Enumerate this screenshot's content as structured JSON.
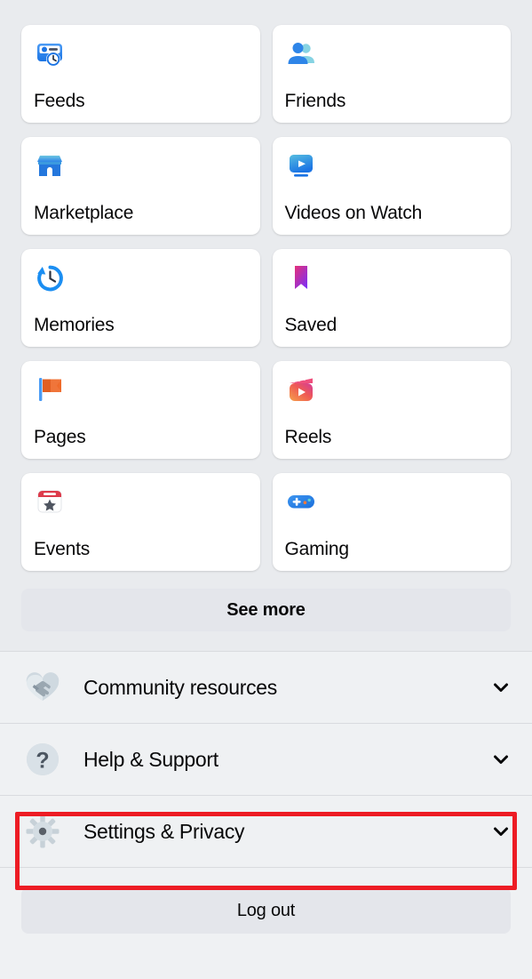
{
  "screen": {
    "name": "facebook-menu",
    "background": "#e9ebee"
  },
  "shortcuts": [
    {
      "label": "Feeds",
      "icon": "feeds-icon"
    },
    {
      "label": "Friends",
      "icon": "friends-icon"
    },
    {
      "label": "Marketplace",
      "icon": "marketplace-icon"
    },
    {
      "label": "Videos on Watch",
      "icon": "videos-on-watch-icon"
    },
    {
      "label": "Memories",
      "icon": "memories-icon"
    },
    {
      "label": "Saved",
      "icon": "saved-bookmark-icon"
    },
    {
      "label": "Pages",
      "icon": "pages-flag-icon"
    },
    {
      "label": "Reels",
      "icon": "reels-icon"
    },
    {
      "label": "Events",
      "icon": "events-calendar-icon"
    },
    {
      "label": "Gaming",
      "icon": "gaming-controller-icon"
    }
  ],
  "see_more": {
    "label": "See more"
  },
  "rows": [
    {
      "label": "Community resources",
      "icon": "handshake-heart-icon",
      "chevron": "chevron-down-icon"
    },
    {
      "label": "Help & Support",
      "icon": "question-mark-icon",
      "chevron": "chevron-down-icon"
    },
    {
      "label": "Settings & Privacy",
      "icon": "gear-icon",
      "chevron": "chevron-down-icon"
    }
  ],
  "logout": {
    "label": "Log out"
  },
  "annotation": {
    "target": "Settings & Privacy",
    "color": "#ed1c24"
  },
  "colors": {
    "page_background": "#e9ebee",
    "card_background": "#ffffff",
    "row_background": "#eff1f3",
    "button_background": "#e4e6eb",
    "text_primary": "#080809",
    "divider": "#d9dbdf",
    "accent_blue": "#1b74e4",
    "highlight_red": "#ed1c24"
  }
}
